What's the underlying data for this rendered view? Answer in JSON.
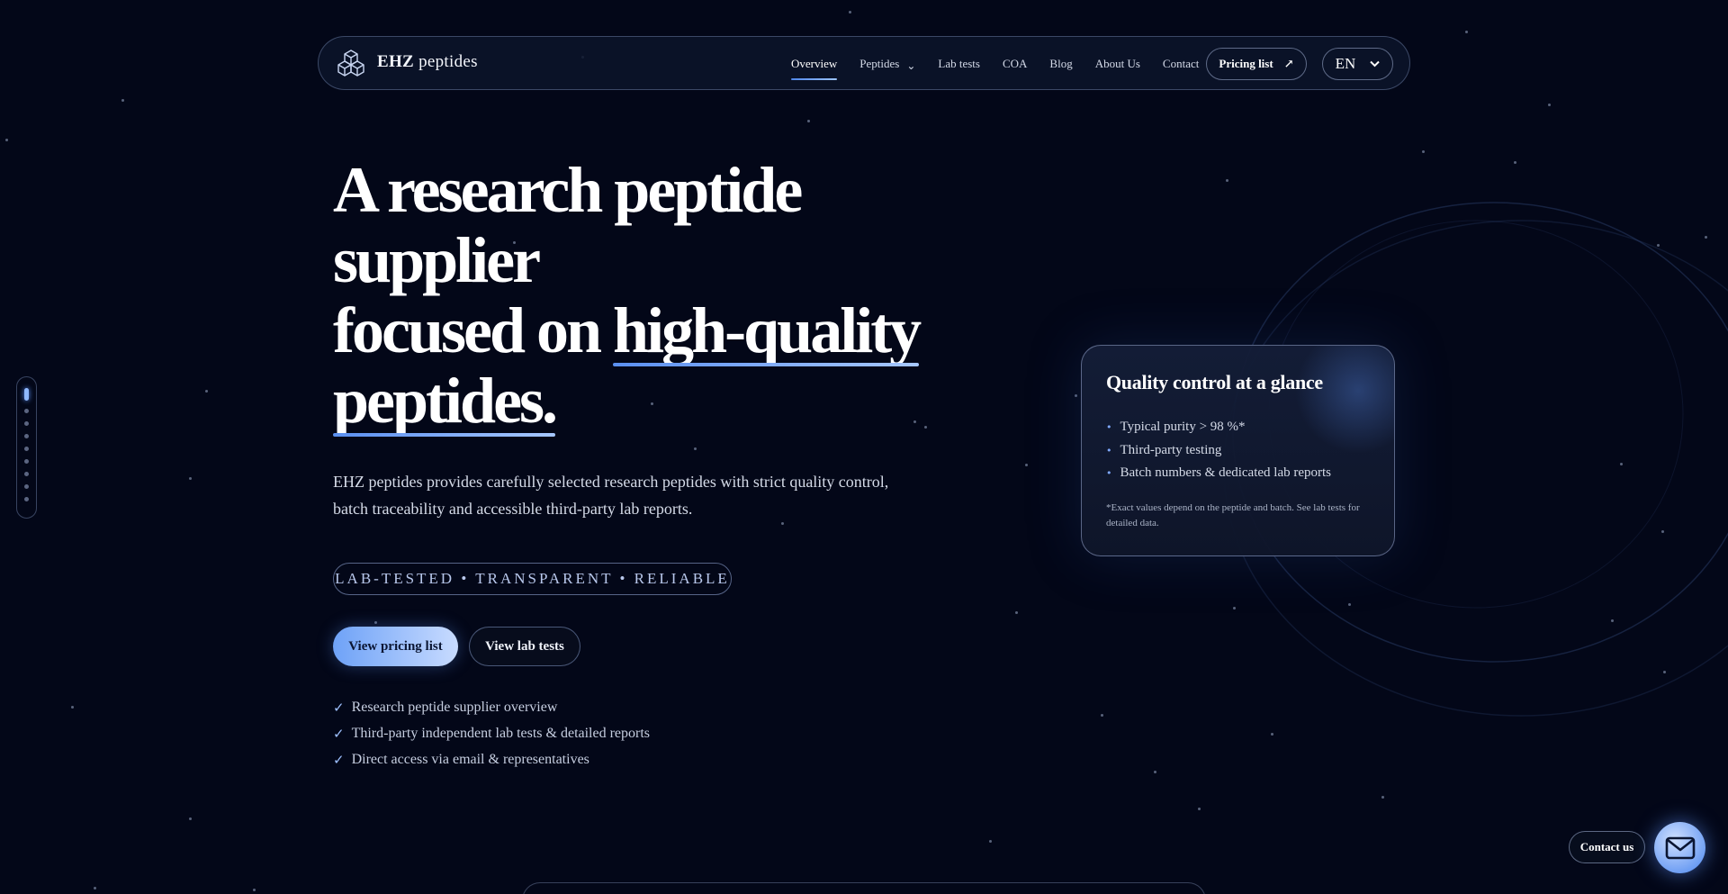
{
  "header": {
    "brand_bold": "EHZ",
    "brand_rest": " peptides",
    "nav": [
      {
        "label": "Overview",
        "active": true
      },
      {
        "label": "Peptides",
        "dropdown": true
      },
      {
        "label": "Lab tests"
      },
      {
        "label": "COA"
      },
      {
        "label": "Blog"
      },
      {
        "label": "About Us"
      },
      {
        "label": "Contact"
      }
    ],
    "pricing_label": "Pricing list",
    "pricing_icon": "↗",
    "language": "EN"
  },
  "hero": {
    "title_line1": "A research peptide supplier",
    "title_line2_prefix": "focused on ",
    "title_highlight1": "high-quality",
    "title_highlight2": "peptides.",
    "description": "EHZ peptides provides carefully selected research peptides with strict quality control, batch traceability and accessible third-party lab reports.",
    "tagline": "LAB-TESTED • TRANSPARENT • RELIABLE",
    "primary_button": "View pricing list",
    "secondary_button": "View lab tests",
    "checks": [
      "Research peptide supplier overview",
      "Third-party independent lab tests & detailed reports",
      "Direct access via email & representatives"
    ],
    "check_symbol": "✓"
  },
  "card": {
    "title": "Quality control at a glance",
    "items": [
      "Typical purity > 98 %*",
      "Third-party testing",
      "Batch numbers & dedicated lab reports"
    ],
    "note": "*Exact values depend on the peptide and batch. See lab tests for detailed data."
  },
  "floating": {
    "contact_label": "Contact us"
  },
  "colors": {
    "background": "#030718",
    "accent": "#6ea2f7",
    "accent_light": "#c8dbff"
  },
  "icons": [
    "logo-cubes-icon",
    "chevron-down-icon",
    "arrow-up-right-icon",
    "check-icon",
    "mail-icon"
  ]
}
